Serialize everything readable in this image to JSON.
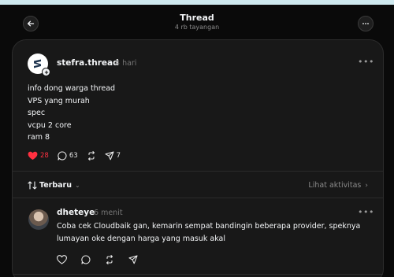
{
  "header": {
    "title": "Thread",
    "subtitle": "4 rb tayangan"
  },
  "post": {
    "username": "stefra.thread",
    "time": "4 hari",
    "lines": [
      "info dong warga thread",
      "VPS yang murah",
      "spec",
      "vcpu 2 core",
      "ram 8"
    ],
    "likes": "28",
    "comments": "63",
    "shares": "7",
    "liked": true
  },
  "sort": {
    "label": "Terbaru",
    "activity_label": "Lihat aktivitas"
  },
  "reply": {
    "username": "dheteye",
    "time": "6 menit",
    "lines": [
      "Coba cek Cloudbaik gan, kemarin sempat bandingin beberapa provider, speknya",
      "lumayan oke dengan harga yang masuk akal"
    ]
  },
  "colors": {
    "like": "#ff3040",
    "background": "#0a0a0a",
    "panel": "#181818"
  },
  "icons": {
    "back": "arrow-left-icon",
    "more": "ellipsis-icon",
    "like": "heart-icon",
    "comment": "comment-bubble-icon",
    "repost": "repost-icon",
    "share": "send-icon",
    "sort": "sort-arrows-icon"
  }
}
